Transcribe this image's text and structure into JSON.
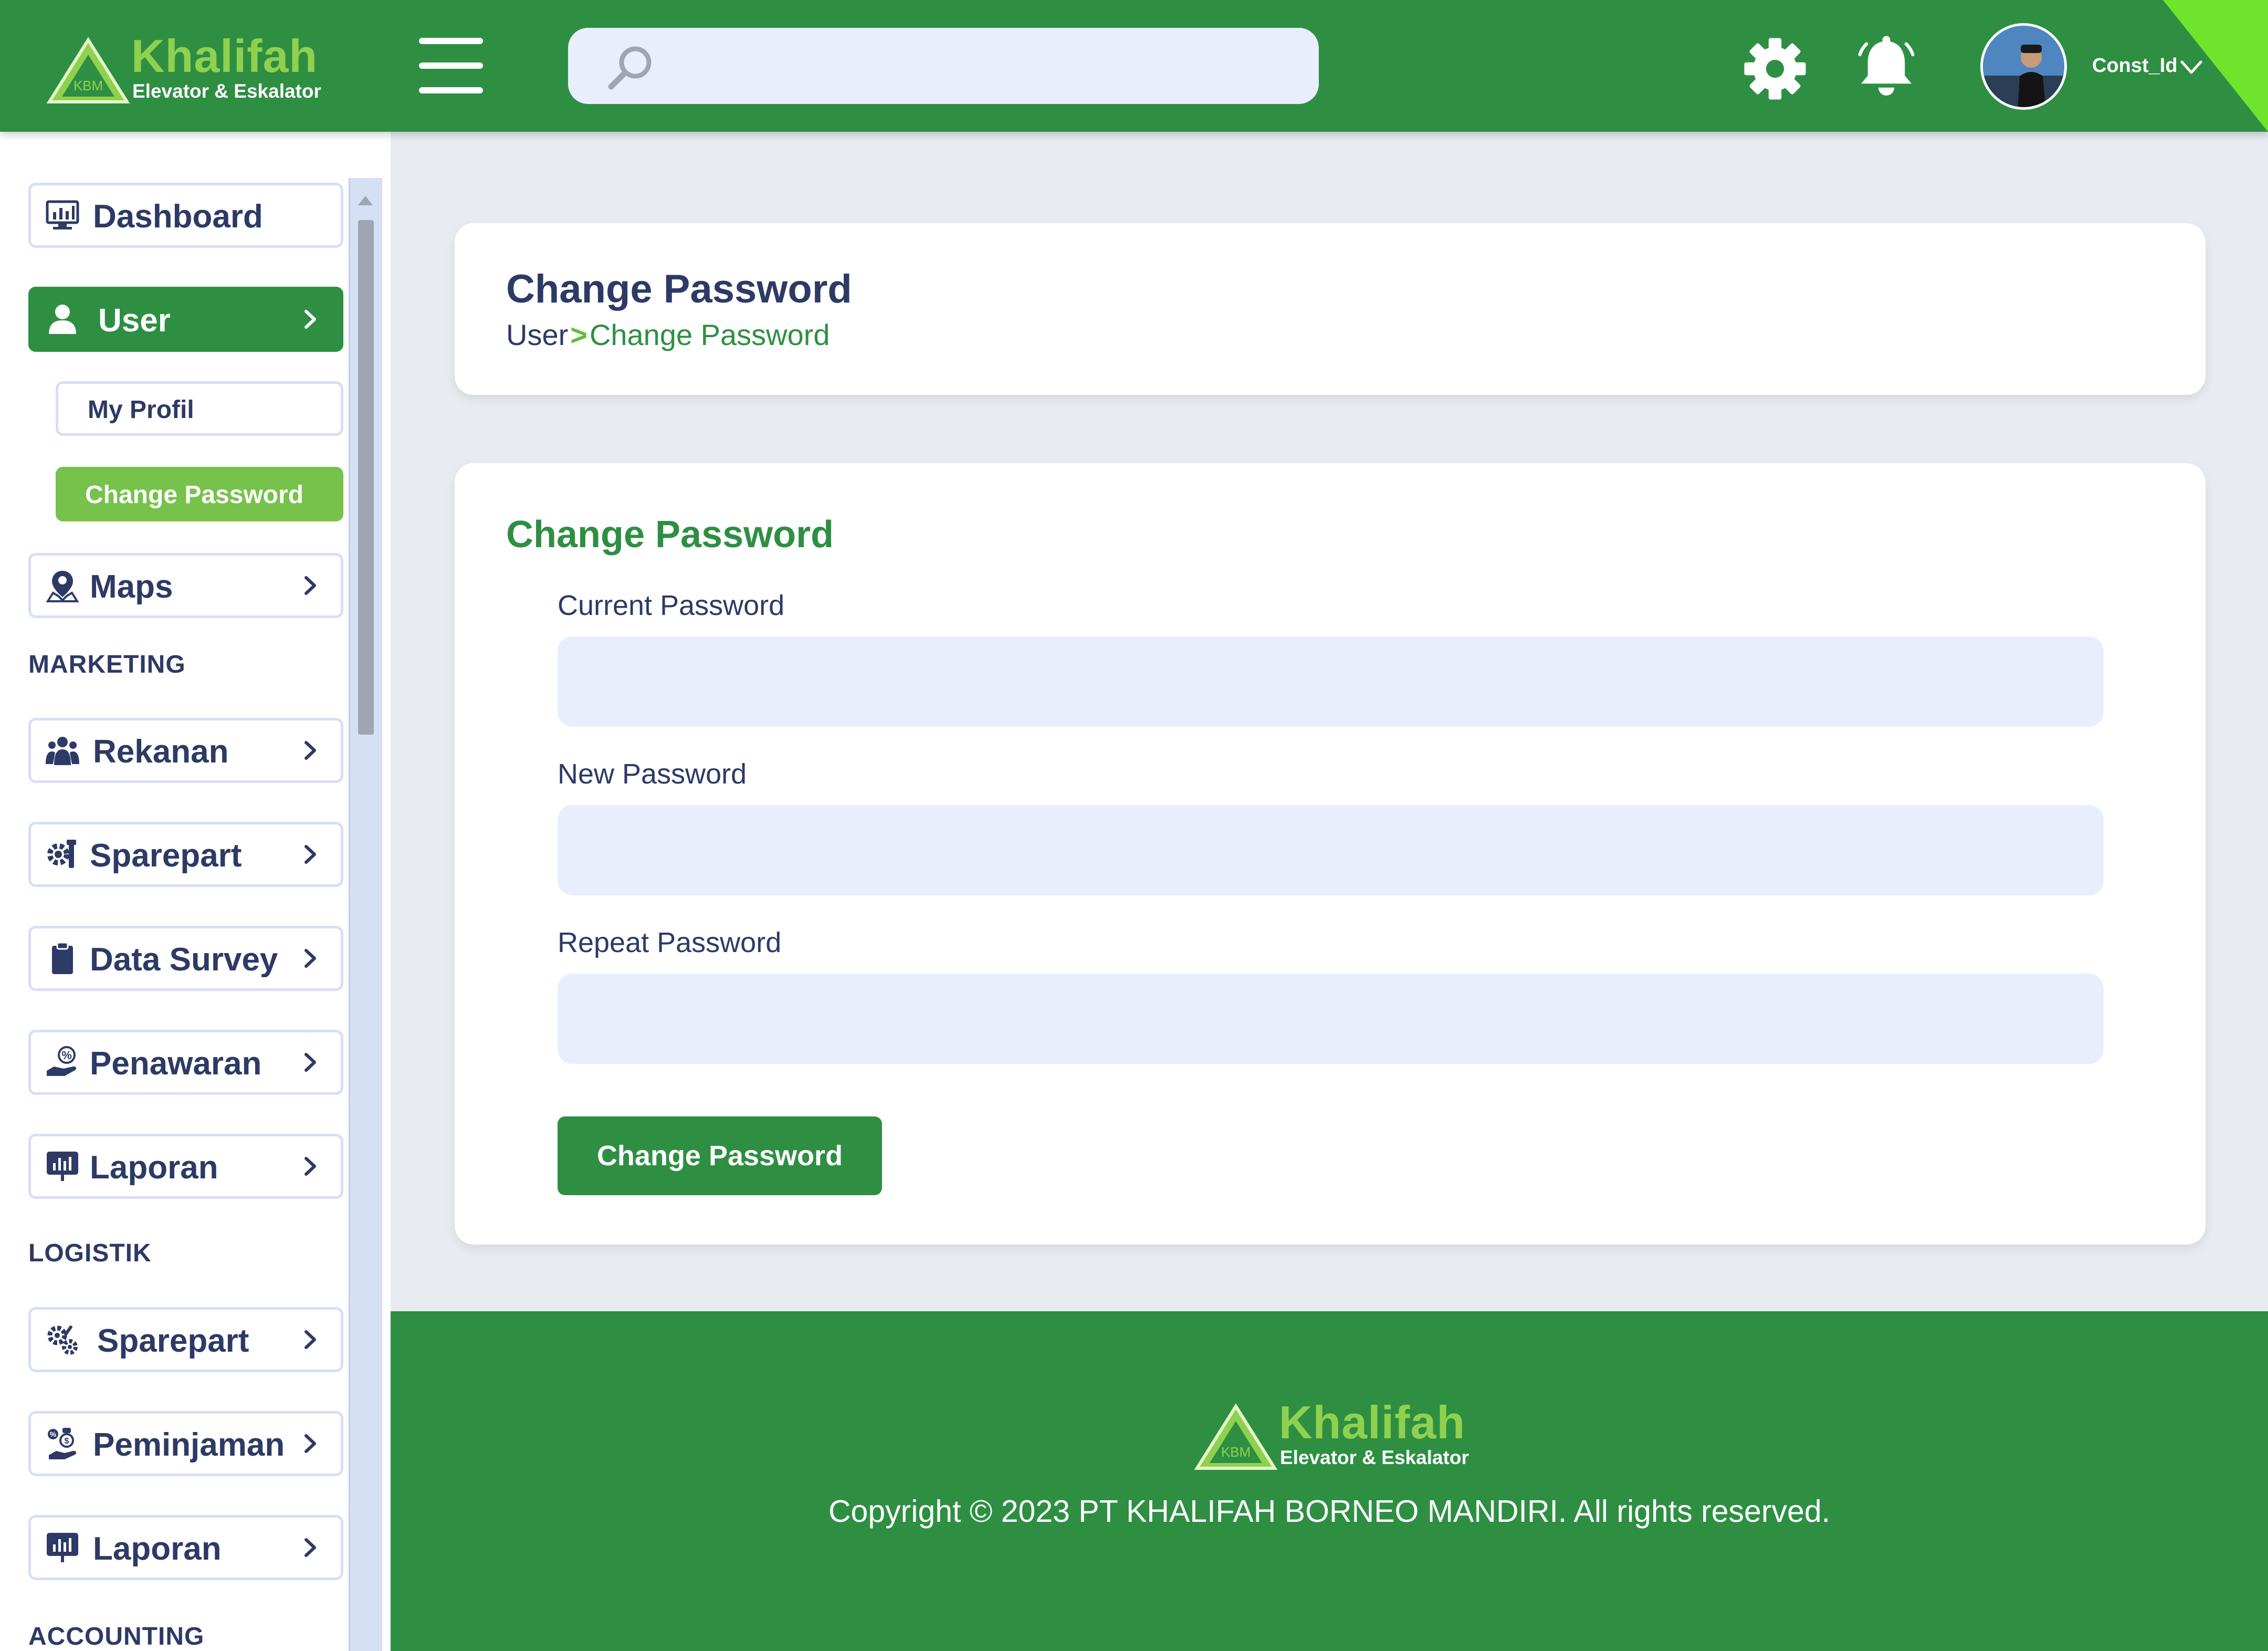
{
  "header": {
    "logo_name": "Khalifah",
    "logo_subtitle": "Elevator & Eskalator",
    "search_placeholder": "",
    "username": "Const_Id"
  },
  "sidebar": {
    "items": [
      {
        "label": "Dashboard",
        "icon": "dashboard-icon"
      },
      {
        "label": "User",
        "icon": "user-icon"
      },
      {
        "label": "My Profil"
      },
      {
        "label": "Change Password"
      },
      {
        "label": "Maps",
        "icon": "map-pin-icon"
      },
      {
        "label": "Rekanan",
        "icon": "people-icon"
      },
      {
        "label": "Sparepart",
        "icon": "tools-icon"
      },
      {
        "label": "Data Survey",
        "icon": "clipboard-icon"
      },
      {
        "label": "Penawaran",
        "icon": "offer-icon"
      },
      {
        "label": "Laporan",
        "icon": "report-icon"
      },
      {
        "label": "Sparepart",
        "icon": "gears-icon"
      },
      {
        "label": "Peminjaman",
        "icon": "loan-icon"
      },
      {
        "label": "Laporan",
        "icon": "report-icon"
      }
    ],
    "sections": [
      "MARKETING",
      "LOGISTIK",
      "ACCOUNTING"
    ]
  },
  "page": {
    "title": "Change Password",
    "breadcrumb_root": "User",
    "breadcrumb_separator": ">",
    "breadcrumb_current": "Change Password"
  },
  "form": {
    "title": "Change Password",
    "current_label": "Current Password",
    "current_value": "",
    "new_label": "New Password",
    "new_value": "",
    "repeat_label": "Repeat Password",
    "repeat_value": "",
    "submit_label": "Change Password"
  },
  "footer": {
    "logo_name": "Khalifah",
    "logo_subtitle": "Elevator & Eskalator",
    "copyright": "Copyright © 2023 PT KHALIFAH BORNEO MANDIRI. All rights reserved."
  },
  "colors": {
    "primary_green": "#2e8f43",
    "light_green": "#76c24a",
    "accent_lime": "#6fe42c",
    "navy_text": "#2d3a66",
    "input_bg": "#e8eefc",
    "page_bg": "#e8ebef"
  }
}
